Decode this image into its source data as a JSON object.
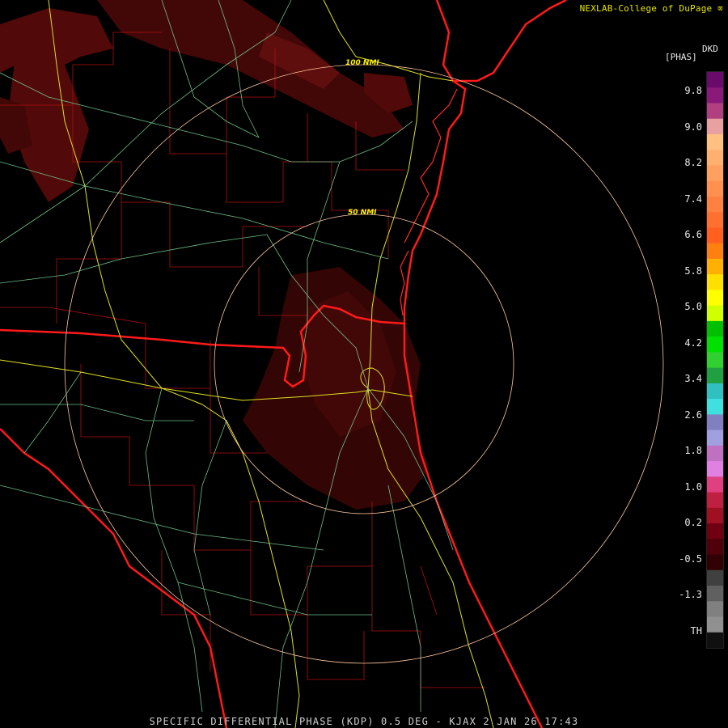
{
  "credit": "NEXLAB-College of DuPage",
  "legend": {
    "title_line1": "DKD",
    "title_line2": "[PHAS]",
    "labels": [
      "9.8",
      "9.0",
      "8.2",
      "7.4",
      "6.6",
      "5.8",
      "5.0",
      "4.2",
      "3.4",
      "2.6",
      "1.8",
      "1.0",
      "0.2",
      "-0.5",
      "-1.3",
      "TH"
    ],
    "colors": [
      "#6a0a6a",
      "#8a1a7a",
      "#b04080",
      "#e8a0a0",
      "#ffc080",
      "#ffb070",
      "#ffa060",
      "#ff9050",
      "#ff8040",
      "#ff7030",
      "#ff6020",
      "#ff8010",
      "#ffb000",
      "#ffe000",
      "#ffff00",
      "#d0ff00",
      "#00c000",
      "#00e000",
      "#30d030",
      "#20a040",
      "#30c0c0",
      "#40e0e0",
      "#8080c0",
      "#a0a0e0",
      "#c070c0",
      "#e080e0",
      "#e04080",
      "#c02040",
      "#a01020",
      "#700010",
      "#500008",
      "#300004",
      "#404040",
      "#606060",
      "#808080",
      "#909090",
      "#101010"
    ]
  },
  "rings": {
    "inner_label": "50 NMI",
    "outer_label": "100 NMI"
  },
  "footer": "SPECIFIC DIFFERENTIAL PHASE (KDP) 0.5 DEG - KJAX 2 JAN 26 17:43"
}
